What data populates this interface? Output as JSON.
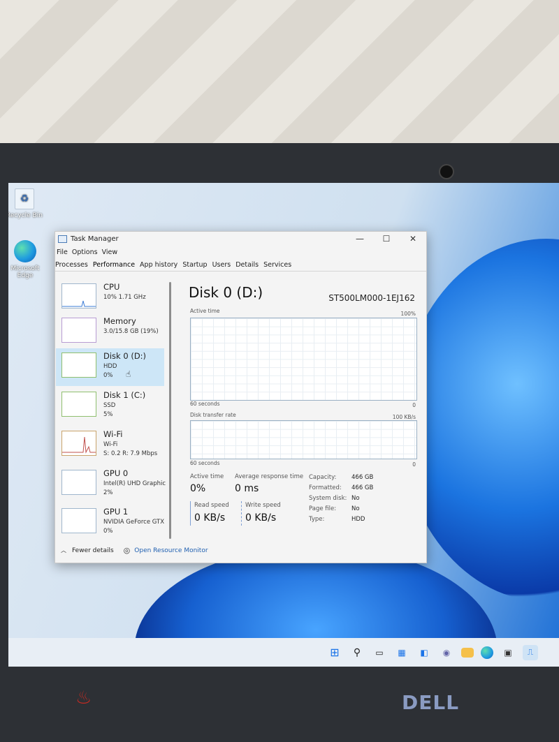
{
  "desktop": {
    "recycle_bin": "Recycle Bin",
    "edge": "Microsoft Edge"
  },
  "window": {
    "title": "Task Manager",
    "minimize": "—",
    "maximize": "☐",
    "close": "✕"
  },
  "menu": [
    "File",
    "Options",
    "View"
  ],
  "tabs": [
    "Processes",
    "Performance",
    "App history",
    "Startup",
    "Users",
    "Details",
    "Services"
  ],
  "sidebar": [
    {
      "name": "CPU",
      "line1": "10% 1.71 GHz",
      "line2": ""
    },
    {
      "name": "Memory",
      "line1": "3.0/15.8 GB (19%)",
      "line2": ""
    },
    {
      "name": "Disk 0 (D:)",
      "line1": "HDD",
      "line2": "0%"
    },
    {
      "name": "Disk 1 (C:)",
      "line1": "SSD",
      "line2": "5%"
    },
    {
      "name": "Wi-Fi",
      "line1": "Wi-Fi",
      "line2": "S: 0.2 R: 7.9 Mbps"
    },
    {
      "name": "GPU 0",
      "line1": "Intel(R) UHD Graphic",
      "line2": "2%"
    },
    {
      "name": "GPU 1",
      "line1": "NVIDIA GeForce GTX",
      "line2": "0%"
    }
  ],
  "detail": {
    "title": "Disk 0 (D:)",
    "model": "ST500LM000-1EJ162",
    "graph1_label": "Active time",
    "graph1_max": "100%",
    "graph1_time": "60 seconds",
    "graph1_min": "0",
    "graph2_label": "Disk transfer rate",
    "graph2_max": "100 KB/s",
    "graph2_time": "60 seconds",
    "graph2_min": "0",
    "active_time_label": "Active time",
    "active_time_value": "0%",
    "avg_resp_label": "Average response time",
    "avg_resp_value": "0 ms",
    "read_label": "Read speed",
    "read_value": "0 KB/s",
    "write_label": "Write speed",
    "write_value": "0 KB/s",
    "props": [
      {
        "k": "Capacity:",
        "v": "466 GB"
      },
      {
        "k": "Formatted:",
        "v": "466 GB"
      },
      {
        "k": "System disk:",
        "v": "No"
      },
      {
        "k": "Page file:",
        "v": "No"
      },
      {
        "k": "Type:",
        "v": "HDD"
      }
    ]
  },
  "footer": {
    "fewer_details": "Fewer details",
    "open_resource_monitor": "Open Resource Monitor"
  },
  "laptop": {
    "brand": "DELL"
  },
  "colors": {
    "accent": "#1f5fb0",
    "selected": "#cde6f7",
    "graph_border": "#9ab0c4"
  }
}
